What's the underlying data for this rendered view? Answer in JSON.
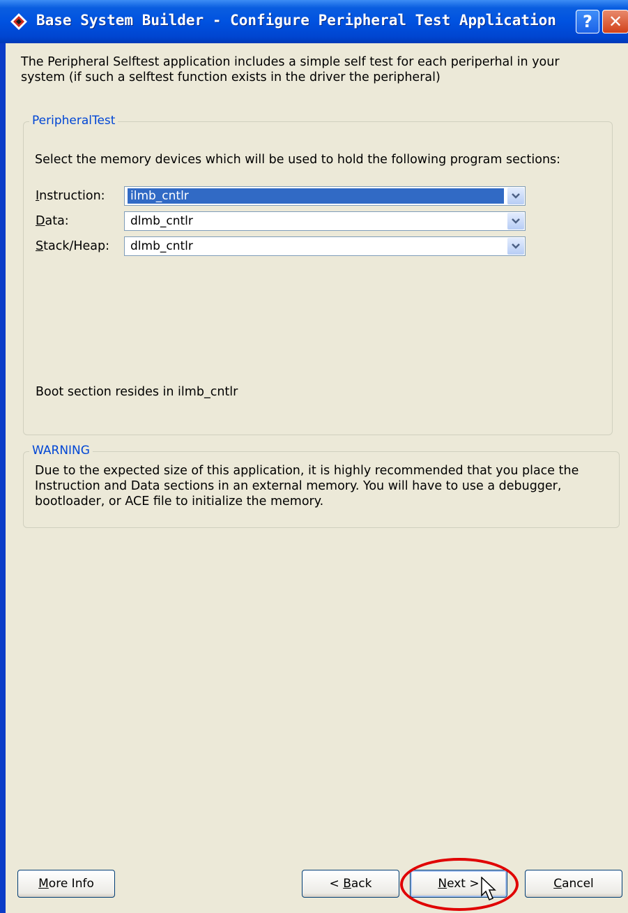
{
  "window": {
    "title": "Base System Builder - Configure Peripheral Test Application",
    "help_glyph": "?",
    "close_glyph": "✕"
  },
  "intro": "The Peripheral Selftest application includes a simple self test for each periperhal in your system (if such a selftest function exists in the driver the peripheral)",
  "peripheral_group": {
    "title": "PeripheralTest",
    "description": "Select the memory devices which will be used to hold the following program sections:",
    "rows": [
      {
        "mnemonic": "I",
        "label_rest": "nstruction:",
        "value": "ilmb_cntlr"
      },
      {
        "mnemonic": "D",
        "label_rest": "ata:",
        "value": "dlmb_cntlr"
      },
      {
        "mnemonic": "S",
        "label_rest": "tack/Heap:",
        "value": "dlmb_cntlr"
      }
    ],
    "boot_note": "Boot section resides in ilmb_cntlr"
  },
  "warning_group": {
    "title": "WARNING",
    "text": "Due to the expected size of this application, it is highly recommended that you place the Instruction and Data sections in an external memory.  You will have to use a debugger, bootloader, or ACE file to initialize the memory."
  },
  "buttons": {
    "more_info": {
      "mnemonic": "M",
      "rest": "ore Info"
    },
    "back": {
      "prefix": "< ",
      "mnemonic": "B",
      "rest": "ack"
    },
    "next": {
      "mnemonic": "N",
      "rest": "ext >"
    },
    "cancel": {
      "mnemonic": "C",
      "rest": "ancel"
    }
  },
  "colors": {
    "title_bar": "#0052e0",
    "client_bg": "#ece9d8",
    "group_title": "#0046d5",
    "selection": "#316ac5",
    "highlight_circle": "#e00000"
  }
}
